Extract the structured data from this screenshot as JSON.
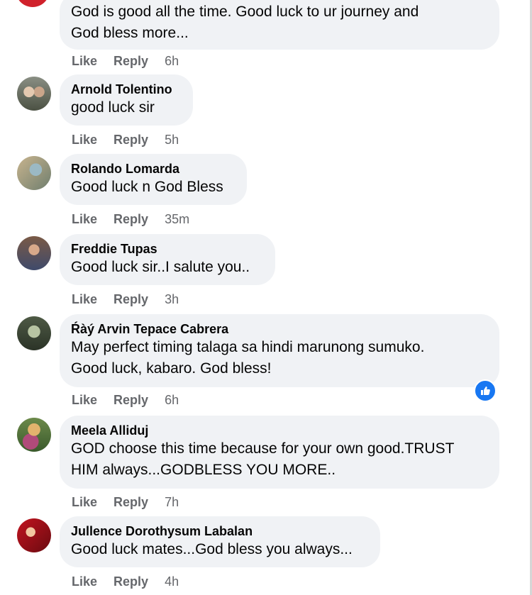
{
  "actions": {
    "like": "Like",
    "reply": "Reply"
  },
  "comments": [
    {
      "name": "",
      "lines": [
        "God is good all the time. Good luck to ur journey and",
        "God bless more..."
      ],
      "time": "6h"
    },
    {
      "name": "Arnold Tolentino",
      "lines": [
        "good luck sir"
      ],
      "time": "5h"
    },
    {
      "name": "Rolando Lomarda",
      "lines": [
        "Good luck n God Bless"
      ],
      "time": "35m"
    },
    {
      "name": "Freddie Tupas",
      "lines": [
        "Good luck sir..I salute you.."
      ],
      "time": "3h"
    },
    {
      "name": "Ŕàý Arvin Tepace Cabrera",
      "lines": [
        "May perfect timing talaga sa hindi marunong sumuko.",
        "Good luck, kabaro. God bless!"
      ],
      "time": "6h",
      "reaction": "like-reaction-icon"
    },
    {
      "name": "Meela Alliduj",
      "lines": [
        "GOD choose this time because for your own good.TRUST",
        "HIM always...GODBLESS YOU MORE.."
      ],
      "time": "7h"
    },
    {
      "name": "Jullence Dorothysum Labalan",
      "lines": [
        "Good luck mates...God bless you always..."
      ],
      "time": "4h"
    }
  ],
  "colors": {
    "bubble": "#f0f2f5",
    "meta": "#65676b",
    "text": "#050505",
    "like_blue": "#1877f2"
  }
}
